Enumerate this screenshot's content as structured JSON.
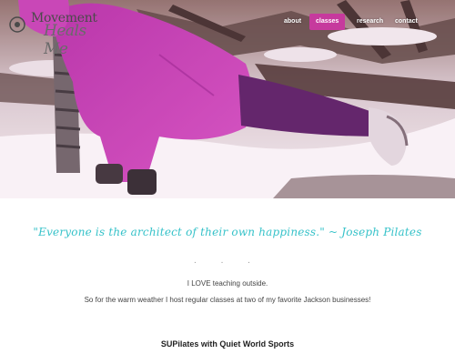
{
  "site": {
    "logo_line1": "Movement",
    "logo_line2": "Heals Me"
  },
  "nav": {
    "items": [
      {
        "label": "about",
        "active": false
      },
      {
        "label": "classes",
        "active": true
      },
      {
        "label": "research",
        "active": false
      },
      {
        "label": "contact",
        "active": false
      }
    ]
  },
  "colors": {
    "accent": "#c63a9d",
    "quote": "#36c2c9"
  },
  "content": {
    "quote": "\"Everyone is the architect of their own happiness.\" ~ Joseph Pilates",
    "separator": ". . .",
    "paragraphs": [
      "I LOVE teaching outside.",
      "So for the warm weather I host regular classes at two of my favorite Jackson businesses!"
    ],
    "section_title": "SUPilates with Quiet World Sports"
  }
}
